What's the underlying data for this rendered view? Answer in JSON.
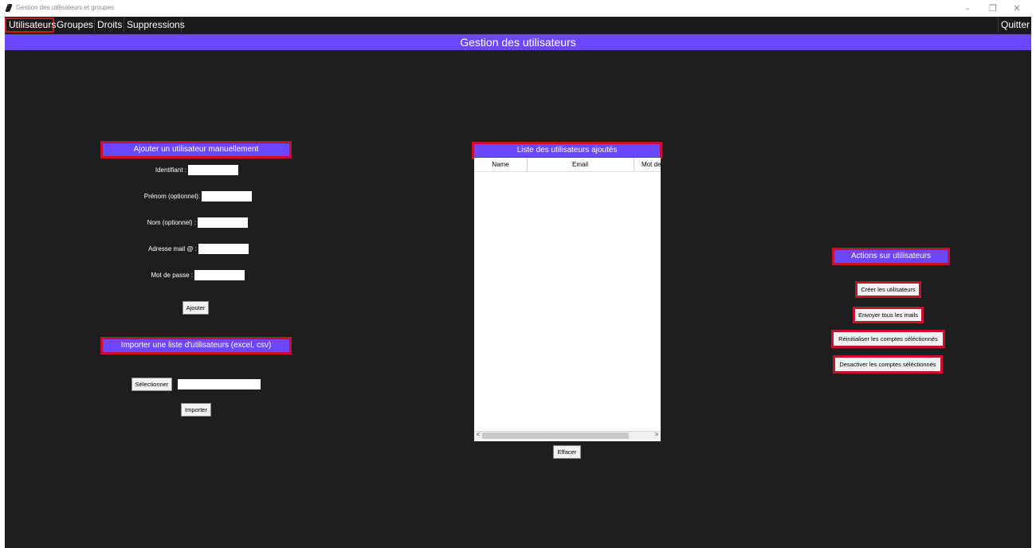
{
  "window": {
    "title": "Gestion des utilisateurs et groupes",
    "controls": {
      "minimize": "–",
      "maximize": "❐",
      "close": "✕"
    }
  },
  "menu": {
    "items": [
      "Utilisateurs",
      "Groupes",
      "Droits",
      "Suppressions"
    ],
    "active": "Utilisateurs",
    "quit": "Quitter"
  },
  "header": {
    "title": "Gestion des utilisateurs"
  },
  "add_user": {
    "title": "Ajouter un utilisateur manuellement",
    "fields": [
      {
        "label": "Identifiant :",
        "value": ""
      },
      {
        "label": "Prénom (optionnel):",
        "value": ""
      },
      {
        "label": "Nom (optionnel) :",
        "value": ""
      },
      {
        "label": "Adresse mail @ :",
        "value": ""
      },
      {
        "label": "Mot de passe :",
        "value": ""
      }
    ],
    "add_button": "Ajouter"
  },
  "import": {
    "title": "Importer une liste d'utilisateurs (excel, csv)",
    "select_button": "Sélectionner",
    "file_value": "",
    "import_button": "Importer"
  },
  "list": {
    "title": "Liste des utilisateurs ajoutés",
    "columns": [
      "Name",
      "Email",
      "Mot de"
    ],
    "rows": [],
    "clear_button": "Effacer",
    "scroll_left": "<",
    "scroll_right": ">"
  },
  "actions": {
    "title": "Actions sur utilisateurs",
    "buttons": [
      "Créer les utilisateurs",
      "Envoyer tous les mails",
      "Réinitialiser les comptes séléctionnés",
      "Desactiver les comptes séléctionnés"
    ]
  },
  "colors": {
    "accent": "#6b48ff",
    "highlight_border": "#c8102e",
    "background": "#1e1e1e"
  }
}
